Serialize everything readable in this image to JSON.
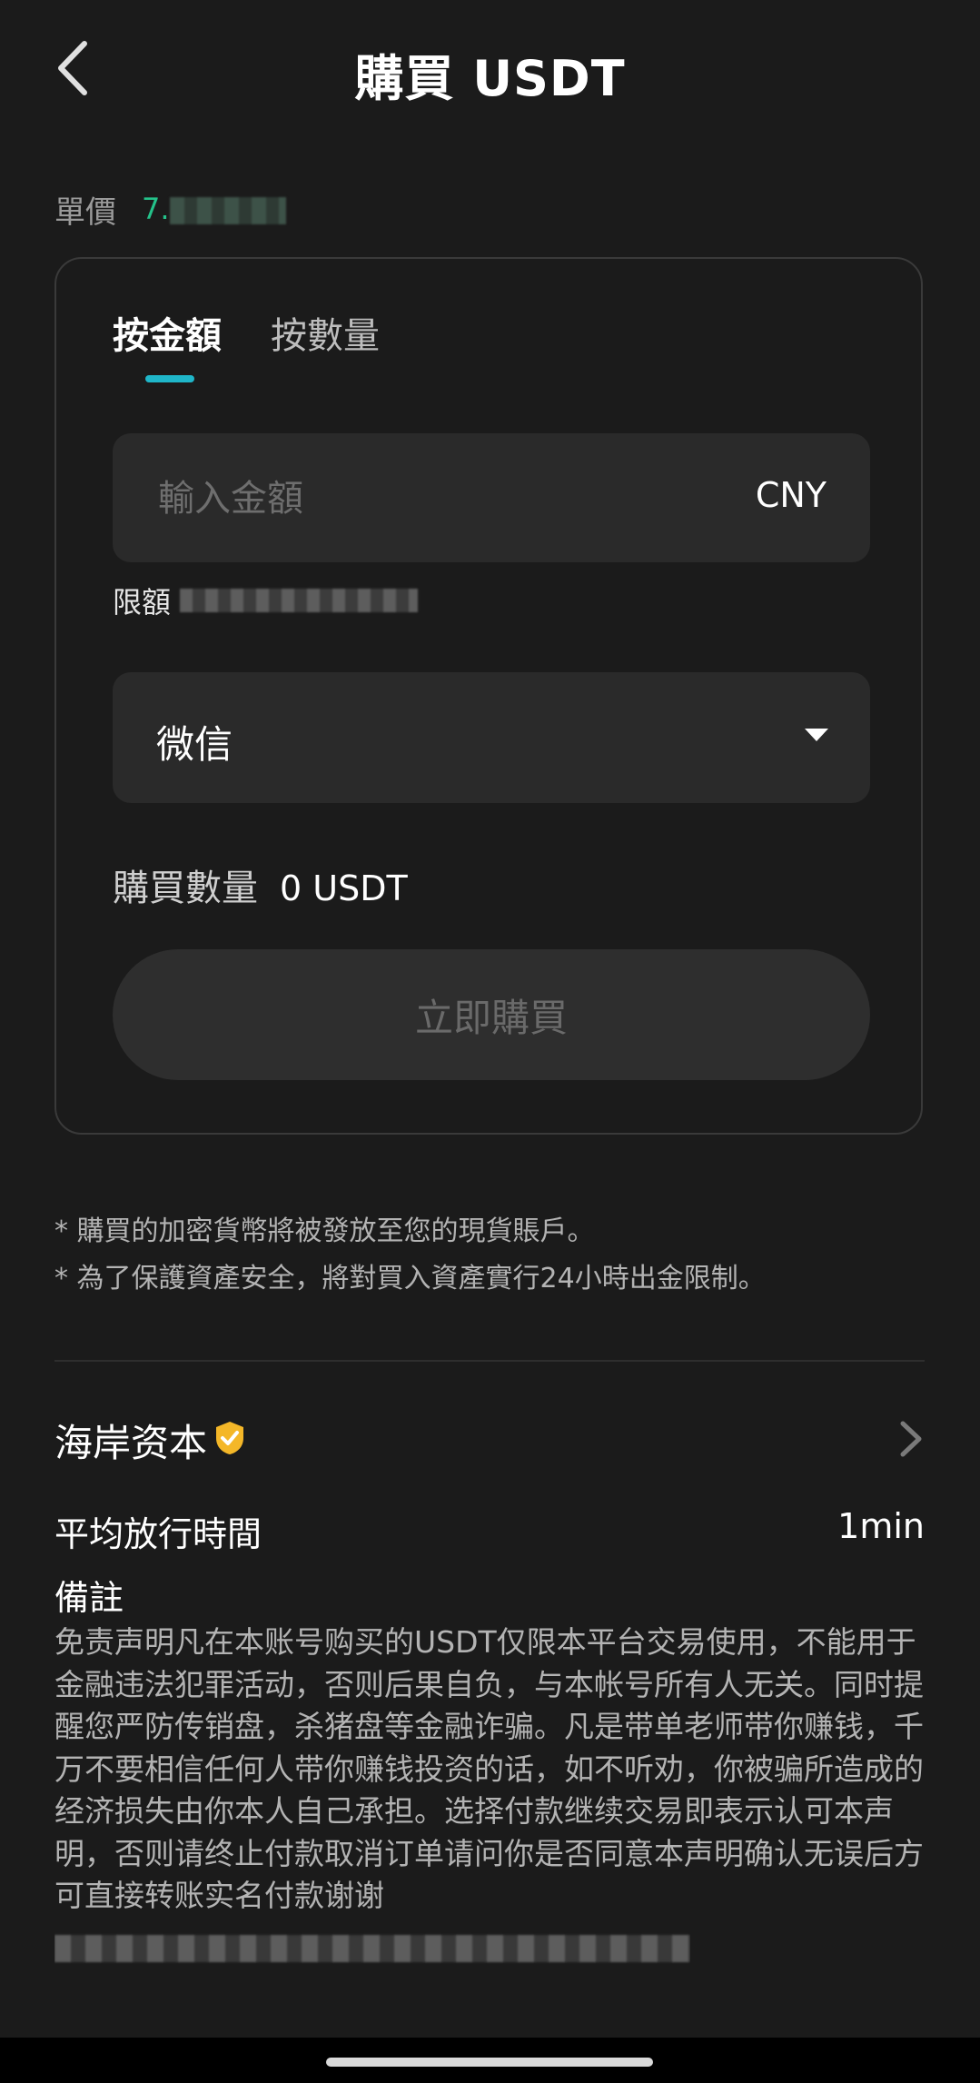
{
  "header": {
    "title": "購買 USDT",
    "back_icon": "chevron-left-icon"
  },
  "price": {
    "label": "單價",
    "value": "7."
  },
  "tabs": [
    {
      "label": "按金額",
      "active": true
    },
    {
      "label": "按數量",
      "active": false
    }
  ],
  "amount_input": {
    "placeholder": "輸入金額",
    "value": "",
    "currency": "CNY"
  },
  "limit": {
    "label": "限額"
  },
  "payment_method": {
    "selected": "微信"
  },
  "quantity": {
    "label": "購買數量",
    "value": "0 USDT"
  },
  "buy_button": {
    "label": "立即購買"
  },
  "notes": [
    "* 購買的加密貨幣將被發放至您的現貨賬戶。",
    "* 為了保護資產安全，將對買入資產實行24小時出金限制。"
  ],
  "merchant": {
    "name": "海岸资本",
    "verified_icon": "verified-shield-icon"
  },
  "release_time": {
    "label": "平均放行時間",
    "value": "1min"
  },
  "remark": {
    "title": "備註",
    "body": "免责声明凡在本账号购买的USDT仅限本平台交易使用，不能用于金融违法犯罪活动，否则后果自负，与本帐号所有人无关。同时提醒您严防传销盘，杀猪盘等金融诈骗。凡是带单老师带你赚钱，千万不要相信任何人带你赚钱投资的话，如不听劝，你被骗所造成的经济损失由你本人自己承担。选择付款继续交易即表示认可本声明，否则请终止付款取消订单请问你是否同意本声明确认无误后方可直接转账实名付款谢谢"
  },
  "colors": {
    "background": "#1b1b1b",
    "accent": "#1fb6c9",
    "price_green": "#24c28a",
    "verified_gold": "#f4b728"
  }
}
